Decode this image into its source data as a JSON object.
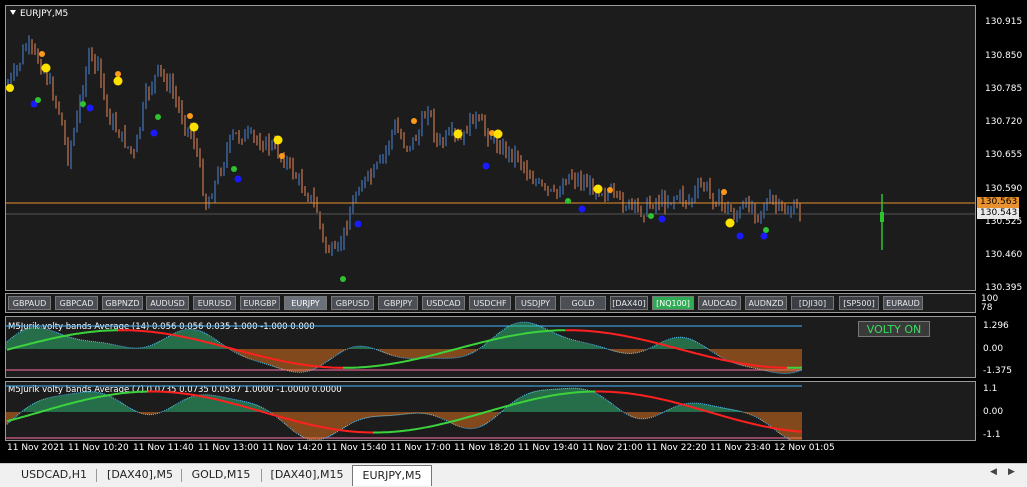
{
  "chart": {
    "symbol_title": "EURJPY,M5",
    "price_labels": [
      "130.915",
      "130.850",
      "130.785",
      "130.720",
      "130.655",
      "130.590",
      "130.525",
      "130.460",
      "130.395"
    ],
    "current_price_orange": "130.563",
    "current_price_white": "130.543",
    "colors": {
      "bull": "#4a86d8",
      "bear": "#e8885a",
      "price_line": "#e8912e",
      "signal_yellow": "#ffe100",
      "signal_orange": "#ff9a1a",
      "signal_green": "#2fc22f",
      "signal_blue": "#1a1aff"
    }
  },
  "symbol_buttons": [
    {
      "label": "GBPAUD"
    },
    {
      "label": "GBPCAD"
    },
    {
      "label": "GBPNZD"
    },
    {
      "label": "AUDUSD"
    },
    {
      "label": "EURUSD"
    },
    {
      "label": "EURGBP"
    },
    {
      "label": "EURJPY"
    },
    {
      "label": "GBPUSD"
    },
    {
      "label": "GBPJPY"
    },
    {
      "label": "USDCAD"
    },
    {
      "label": "USDCHF"
    },
    {
      "label": "USDJPY"
    },
    {
      "label": "GOLD"
    },
    {
      "label": "[DAX40]"
    },
    {
      "label": "[NQ100]"
    },
    {
      "label": "AUDCAD"
    },
    {
      "label": "AUDNZD"
    },
    {
      "label": "[DJI30]"
    },
    {
      "label": "[SP500]"
    },
    {
      "label": "EURAUD"
    }
  ],
  "button_row_axis": [
    "100",
    "78"
  ],
  "indicator1": {
    "title": "M5Jurik volty bands Average (14) 0.056 0.056 0.035 1.000 -1.000 0.000",
    "labels": [
      "1.296",
      "0.00",
      "-1.375"
    ]
  },
  "indicator2": {
    "title": "M5Jurik volty bands Average (7) 0.0735 0.0735 0.0587 1.0000 -1.0000 0.0000",
    "labels": [
      "1.1",
      "0.00",
      "-1.1"
    ]
  },
  "volty_button": "VOLTY ON",
  "time_labels": [
    "11 Nov 2021",
    "11 Nov 10:20",
    "11 Nov 11:40",
    "11 Nov 13:00",
    "11 Nov 14:20",
    "11 Nov 15:40",
    "11 Nov 17:00",
    "11 Nov 18:20",
    "11 Nov 19:40",
    "11 Nov 21:00",
    "11 Nov 22:20",
    "11 Nov 23:40",
    "12 Nov 01:05"
  ],
  "tabs": [
    {
      "label": "USDCAD,H1"
    },
    {
      "label": "[DAX40],M5"
    },
    {
      "label": "GOLD,M15"
    },
    {
      "label": "[DAX40],M15"
    },
    {
      "label": "EURJPY,M5"
    }
  ]
}
